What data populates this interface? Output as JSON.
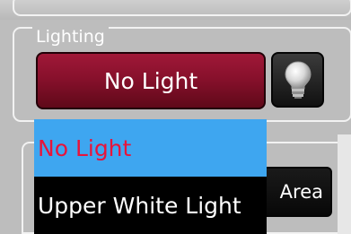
{
  "lighting": {
    "group_title": "Lighting",
    "current_mode": "No Light",
    "bulb_icon": "light-bulb-icon"
  },
  "dropdown": {
    "options": [
      "No Light",
      "Upper White Light"
    ],
    "selected": "No Light"
  },
  "lower_group": {
    "area_button_label": "Area"
  },
  "colors": {
    "mode_button": "#86102b",
    "selected_item_bg": "#3ea6f0",
    "selected_item_text": "#e8143a",
    "panel_bg": "#bdbdbd"
  }
}
